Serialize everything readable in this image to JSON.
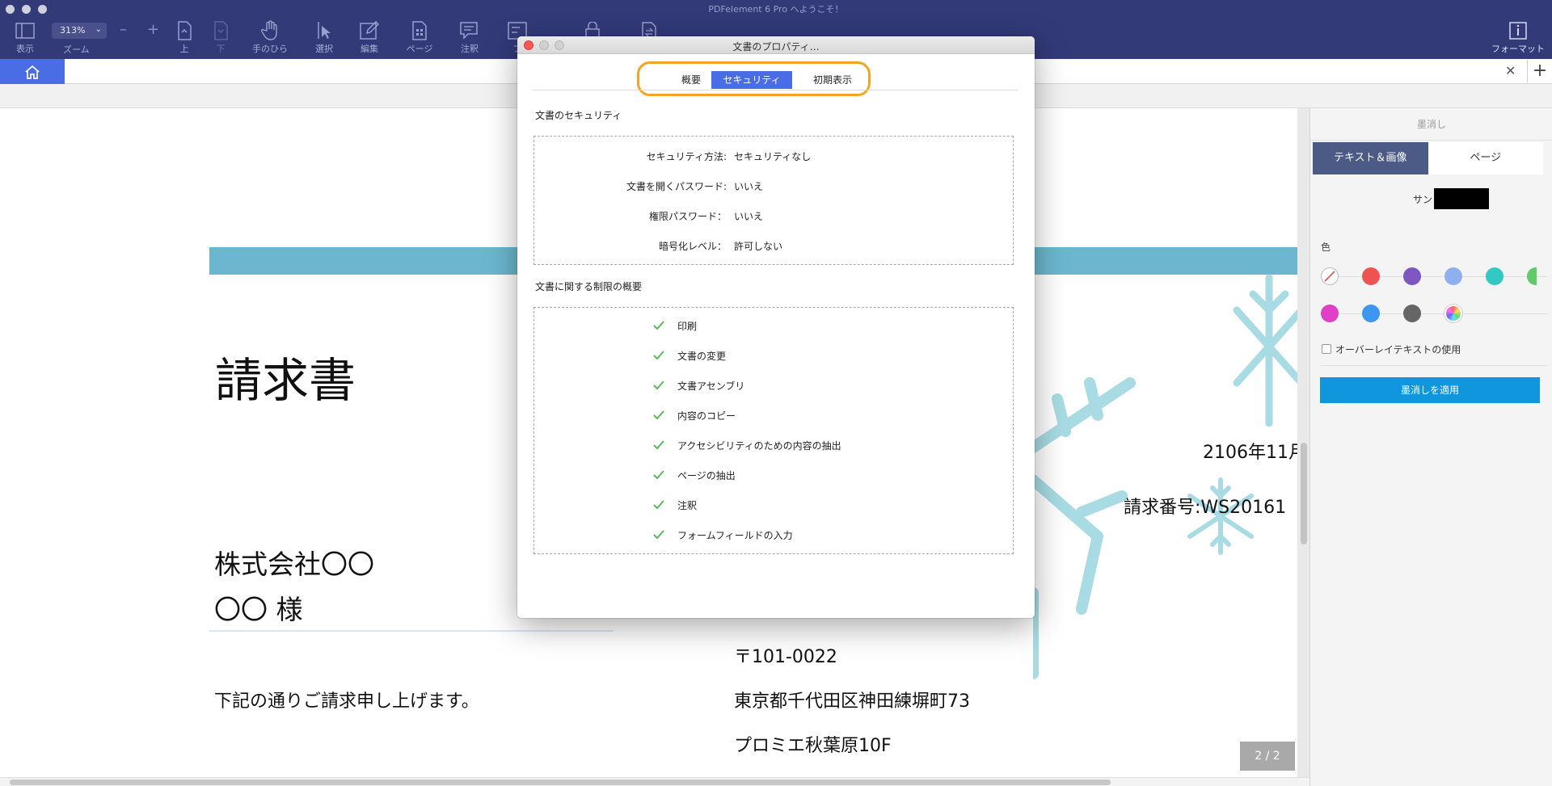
{
  "app": {
    "title": "PDFelement 6 Pro へようこそ！"
  },
  "toolbar": {
    "view_label": "表示",
    "zoom_value": "313%",
    "zoom_label": "ズーム",
    "up_label": "上",
    "down_label": "下",
    "hand_label": "手のひら",
    "select_label": "選択",
    "edit_label": "編集",
    "page_label": "ページ",
    "annotate_label": "注釈",
    "form_label": "フ",
    "format_label": "フォーマット"
  },
  "document": {
    "title": "請求書",
    "company": "株式会社〇〇",
    "recipient": "〇〇 様",
    "intro": "下記の通りご請求申し上げます。",
    "postal": "〒101-0022",
    "address": "東京都千代田区神田練塀町73",
    "building": "プロミエ秋葉原10F",
    "date_partial": "2106年11月",
    "invoice_partial": "請求番号:WS20161",
    "page_indicator": "2 / 2"
  },
  "dialog": {
    "title": "文書のプロパティ…",
    "tabs": [
      "概要",
      "セキュリティ",
      "初期表示"
    ],
    "active_tab": "セキュリティ",
    "security_section": "文書のセキュリティ",
    "security_rows": [
      {
        "label": "セキュリティ方法:",
        "value": "セキュリティなし"
      },
      {
        "label": "文書を開くパスワード:",
        "value": "いいえ"
      },
      {
        "label": "権限パスワード：",
        "value": "いいえ"
      },
      {
        "label": "暗号化レベル：",
        "value": "許可しない"
      }
    ],
    "restrictions_section": "文書に関する制限の概要",
    "permissions": [
      "印刷",
      "文書の変更",
      "文書アセンブリ",
      "内容のコピー",
      "アクセシビリティのための内容の抽出",
      "ページの抽出",
      "注釈",
      "フォームフィールドの入力"
    ]
  },
  "right_panel": {
    "header": "墨消し",
    "tab_text_image": "テキスト＆画像",
    "tab_page": "ページ",
    "sample_label": "サン",
    "color_label": "色",
    "colors_row1": [
      "none",
      "#ef5350",
      "#7e57c2",
      "#8fb0ef",
      "#32c9c2",
      "#5fcc6a"
    ],
    "colors_row2": [
      "#e040c8",
      "#3e95f2",
      "#666666",
      "rainbow"
    ],
    "overlay_text_label": "オーバーレイテキストの使用",
    "apply_button": "墨消しを適用"
  },
  "colors": {
    "accent_blue": "#4a6de5",
    "toolbar_bg": "#323a78",
    "highlight_orange": "#f0a623",
    "check_green": "#5cb85c",
    "apply_blue": "#0f96dc"
  }
}
